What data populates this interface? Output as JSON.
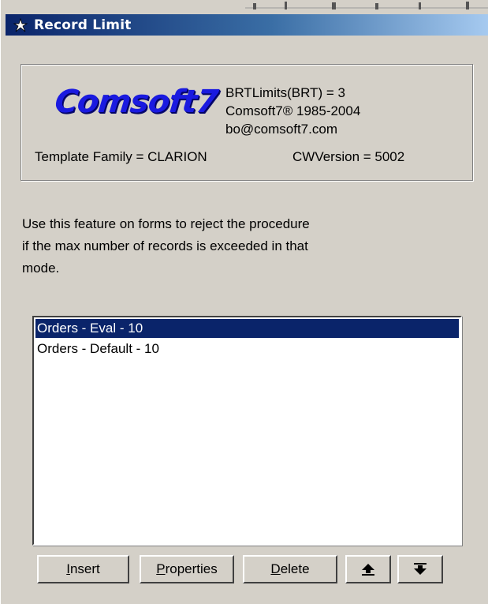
{
  "window": {
    "title": "Record Limit"
  },
  "info": {
    "logo_text": "Comsoft7",
    "line1": "BRTLimits(BRT) = 3",
    "line2": "Comsoft7® 1985-2004",
    "line3": "bo@comsoft7.com",
    "template_family": "Template Family = CLARION",
    "cw_version": "CWVersion = 5002"
  },
  "description": {
    "line1": "Use this feature on forms to reject the procedure",
    "line2": "if the max number of records is exceeded in that",
    "line3": "mode."
  },
  "list": {
    "items": [
      {
        "label": "Orders - Eval - 10",
        "selected": true
      },
      {
        "label": "Orders - Default - 10",
        "selected": false
      }
    ]
  },
  "buttons": {
    "insert_first": "I",
    "insert_rest": "nsert",
    "properties_first": "P",
    "properties_rest": "roperties",
    "delete_first": "D",
    "delete_rest": "elete",
    "move_up_icon": "arrow-up-icon",
    "move_down_icon": "arrow-down-icon"
  },
  "colors": {
    "face": "#d4d0c8",
    "title_start": "#0a246a",
    "title_end": "#a6caf0",
    "selection": "#0a246a",
    "logo": "#1a1ae0"
  }
}
